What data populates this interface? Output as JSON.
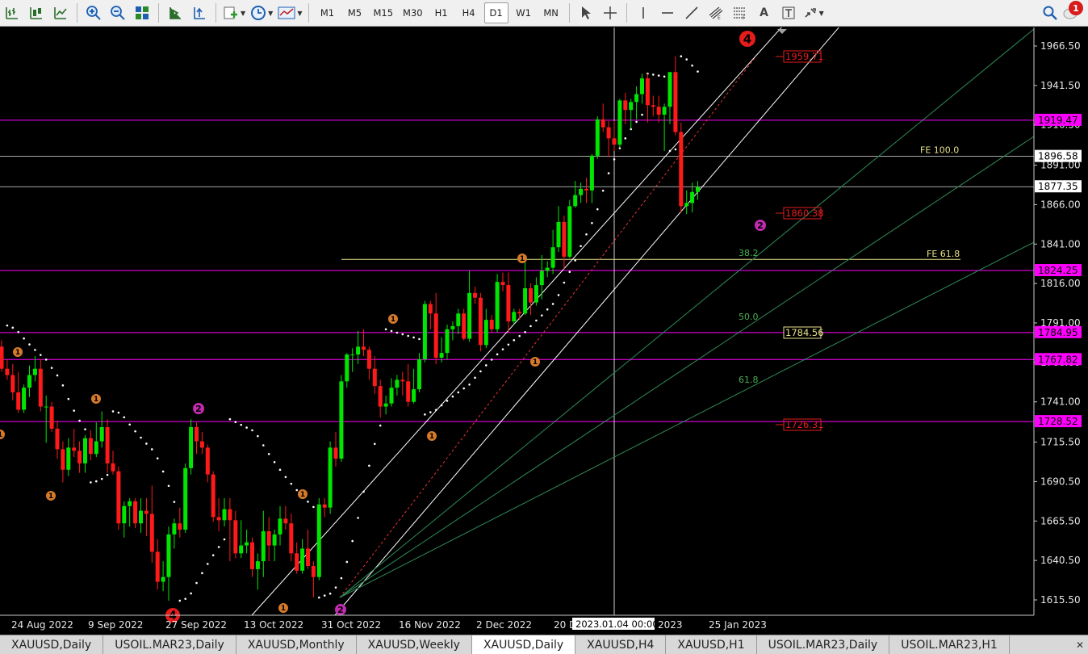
{
  "toolbar": {
    "timeframes": [
      "M1",
      "M5",
      "M15",
      "M30",
      "H1",
      "H4",
      "D1",
      "W1",
      "MN"
    ],
    "active_timeframe": "D1",
    "draw_tool_letter_a": "A",
    "notification_count": "1"
  },
  "chart_data": {
    "type": "candlestick",
    "symbol": "XAUUSD",
    "timeframe": "Daily",
    "y_axis": {
      "ticks": [
        "1966.50",
        "1941.50",
        "1916.50",
        "1891.00",
        "1866.00",
        "1841.00",
        "1816.00",
        "1791.00",
        "1766.00",
        "1741.00",
        "1715.50",
        "1690.50",
        "1665.50",
        "1640.50",
        "1615.50"
      ]
    },
    "x_axis": {
      "labels": [
        "24 Aug 2022",
        "9 Sep 2022",
        "27 Sep 2022",
        "13 Oct 2022",
        "31 Oct 2022",
        "16 Nov 2022",
        "2 Dec 2022",
        "20 D",
        "2023",
        "25 Jan 2023"
      ],
      "crosshair_label": "2023.01.04 00:00"
    },
    "price_labels": {
      "magenta": [
        "1919.47",
        "1824.25",
        "1784.95",
        "1767.82",
        "1728.52"
      ],
      "white": [
        "1896.58",
        "1877.35"
      ],
      "red_boxes": [
        "1959.71",
        "1860.38",
        "1726.31"
      ],
      "yellow_box": "1784.56"
    },
    "horizontal_levels": {
      "magenta": [
        1919.47,
        1824.25,
        1784.95,
        1767.82,
        1728.52
      ],
      "white": [
        1896.58,
        1877.35
      ],
      "yellow_fe618": 1831.3
    },
    "fib_labels": [
      "FE 100.0",
      "FE 61.8",
      "38.2",
      "50.0",
      "61.8"
    ],
    "wave_labels": {
      "red_big": [
        "4",
        "4"
      ],
      "magenta": [
        "2",
        "2",
        "2"
      ],
      "orange": [
        "1",
        "1",
        "1",
        "1",
        "1",
        "1",
        "1",
        "1",
        "1"
      ]
    },
    "candles": [
      {
        "d": "2022-08-17",
        "o": 1776,
        "h": 1780,
        "l": 1760,
        "c": 1762
      },
      {
        "d": "2022-08-18",
        "o": 1762,
        "h": 1768,
        "l": 1755,
        "c": 1758
      },
      {
        "d": "2022-08-19",
        "o": 1758,
        "h": 1765,
        "l": 1742,
        "c": 1747
      },
      {
        "d": "2022-08-22",
        "o": 1747,
        "h": 1760,
        "l": 1734,
        "c": 1736
      },
      {
        "d": "2022-08-23",
        "o": 1736,
        "h": 1752,
        "l": 1734,
        "c": 1750
      },
      {
        "d": "2022-08-24",
        "o": 1750,
        "h": 1764,
        "l": 1744,
        "c": 1758
      },
      {
        "d": "2022-08-25",
        "o": 1758,
        "h": 1770,
        "l": 1754,
        "c": 1762
      },
      {
        "d": "2022-08-26",
        "o": 1762,
        "h": 1768,
        "l": 1735,
        "c": 1738
      },
      {
        "d": "2022-08-29",
        "o": 1738,
        "h": 1745,
        "l": 1715,
        "c": 1738
      },
      {
        "d": "2022-08-30",
        "o": 1738,
        "h": 1741,
        "l": 1722,
        "c": 1724
      },
      {
        "d": "2022-08-31",
        "o": 1724,
        "h": 1729,
        "l": 1705,
        "c": 1711
      },
      {
        "d": "2022-09-01",
        "o": 1711,
        "h": 1716,
        "l": 1690,
        "c": 1698
      },
      {
        "d": "2022-09-02",
        "o": 1698,
        "h": 1718,
        "l": 1694,
        "c": 1712
      },
      {
        "d": "2022-09-05",
        "o": 1712,
        "h": 1724,
        "l": 1706,
        "c": 1710
      },
      {
        "d": "2022-09-06",
        "o": 1710,
        "h": 1716,
        "l": 1696,
        "c": 1702
      },
      {
        "d": "2022-09-07",
        "o": 1702,
        "h": 1720,
        "l": 1696,
        "c": 1718
      },
      {
        "d": "2022-09-08",
        "o": 1718,
        "h": 1723,
        "l": 1704,
        "c": 1708
      },
      {
        "d": "2022-09-09",
        "o": 1708,
        "h": 1728,
        "l": 1706,
        "c": 1716
      },
      {
        "d": "2022-09-12",
        "o": 1716,
        "h": 1735,
        "l": 1712,
        "c": 1725
      },
      {
        "d": "2022-09-13",
        "o": 1725,
        "h": 1730,
        "l": 1696,
        "c": 1702
      },
      {
        "d": "2022-09-14",
        "o": 1702,
        "h": 1710,
        "l": 1695,
        "c": 1697
      },
      {
        "d": "2022-09-15",
        "o": 1697,
        "h": 1700,
        "l": 1660,
        "c": 1664
      },
      {
        "d": "2022-09-16",
        "o": 1664,
        "h": 1678,
        "l": 1655,
        "c": 1675
      },
      {
        "d": "2022-09-19",
        "o": 1675,
        "h": 1680,
        "l": 1662,
        "c": 1678
      },
      {
        "d": "2022-09-20",
        "o": 1678,
        "h": 1680,
        "l": 1661,
        "c": 1664
      },
      {
        "d": "2022-09-21",
        "o": 1664,
        "h": 1680,
        "l": 1658,
        "c": 1672
      },
      {
        "d": "2022-09-22",
        "o": 1672,
        "h": 1680,
        "l": 1656,
        "c": 1670
      },
      {
        "d": "2022-09-23",
        "o": 1670,
        "h": 1688,
        "l": 1639,
        "c": 1646
      },
      {
        "d": "2022-09-26",
        "o": 1646,
        "h": 1654,
        "l": 1622,
        "c": 1627
      },
      {
        "d": "2022-09-27",
        "o": 1627,
        "h": 1640,
        "l": 1621,
        "c": 1630
      },
      {
        "d": "2022-09-28",
        "o": 1630,
        "h": 1662,
        "l": 1615,
        "c": 1657
      },
      {
        "d": "2022-09-29",
        "o": 1657,
        "h": 1667,
        "l": 1648,
        "c": 1664
      },
      {
        "d": "2022-09-30",
        "o": 1664,
        "h": 1674,
        "l": 1655,
        "c": 1660
      },
      {
        "d": "2022-10-03",
        "o": 1660,
        "h": 1702,
        "l": 1658,
        "c": 1699
      },
      {
        "d": "2022-10-04",
        "o": 1699,
        "h": 1730,
        "l": 1695,
        "c": 1725
      },
      {
        "d": "2022-10-05",
        "o": 1725,
        "h": 1728,
        "l": 1708,
        "c": 1716
      },
      {
        "d": "2022-10-06",
        "o": 1716,
        "h": 1722,
        "l": 1708,
        "c": 1712
      },
      {
        "d": "2022-10-07",
        "o": 1712,
        "h": 1714,
        "l": 1690,
        "c": 1695
      },
      {
        "d": "2022-10-10",
        "o": 1695,
        "h": 1697,
        "l": 1665,
        "c": 1668
      },
      {
        "d": "2022-10-11",
        "o": 1668,
        "h": 1680,
        "l": 1659,
        "c": 1666
      },
      {
        "d": "2022-10-12",
        "o": 1666,
        "h": 1680,
        "l": 1662,
        "c": 1673
      },
      {
        "d": "2022-10-13",
        "o": 1673,
        "h": 1680,
        "l": 1640,
        "c": 1666
      },
      {
        "d": "2022-10-14",
        "o": 1666,
        "h": 1672,
        "l": 1642,
        "c": 1645
      },
      {
        "d": "2022-10-17",
        "o": 1645,
        "h": 1666,
        "l": 1642,
        "c": 1650
      },
      {
        "d": "2022-10-18",
        "o": 1650,
        "h": 1660,
        "l": 1645,
        "c": 1652
      },
      {
        "d": "2022-10-19",
        "o": 1652,
        "h": 1655,
        "l": 1630,
        "c": 1635
      },
      {
        "d": "2022-10-20",
        "o": 1635,
        "h": 1645,
        "l": 1622,
        "c": 1640
      },
      {
        "d": "2022-10-21",
        "o": 1640,
        "h": 1672,
        "l": 1630,
        "c": 1659
      },
      {
        "d": "2022-10-24",
        "o": 1659,
        "h": 1668,
        "l": 1640,
        "c": 1650
      },
      {
        "d": "2022-10-25",
        "o": 1650,
        "h": 1660,
        "l": 1640,
        "c": 1657
      },
      {
        "d": "2022-10-26",
        "o": 1657,
        "h": 1675,
        "l": 1650,
        "c": 1667
      },
      {
        "d": "2022-10-27",
        "o": 1667,
        "h": 1675,
        "l": 1660,
        "c": 1664
      },
      {
        "d": "2022-10-28",
        "o": 1664,
        "h": 1670,
        "l": 1640,
        "c": 1645
      },
      {
        "d": "2022-10-31",
        "o": 1645,
        "h": 1652,
        "l": 1632,
        "c": 1634
      },
      {
        "d": "2022-11-01",
        "o": 1634,
        "h": 1654,
        "l": 1632,
        "c": 1648
      },
      {
        "d": "2022-11-02",
        "o": 1648,
        "h": 1660,
        "l": 1635,
        "c": 1637
      },
      {
        "d": "2022-11-03",
        "o": 1637,
        "h": 1640,
        "l": 1617,
        "c": 1630
      },
      {
        "d": "2022-11-04",
        "o": 1630,
        "h": 1680,
        "l": 1628,
        "c": 1676
      },
      {
        "d": "2022-11-07",
        "o": 1676,
        "h": 1680,
        "l": 1668,
        "c": 1674
      },
      {
        "d": "2022-11-08",
        "o": 1674,
        "h": 1716,
        "l": 1670,
        "c": 1712
      },
      {
        "d": "2022-11-09",
        "o": 1712,
        "h": 1722,
        "l": 1700,
        "c": 1705
      },
      {
        "d": "2022-11-10",
        "o": 1705,
        "h": 1758,
        "l": 1703,
        "c": 1754
      },
      {
        "d": "2022-11-11",
        "o": 1754,
        "h": 1772,
        "l": 1750,
        "c": 1771
      },
      {
        "d": "2022-11-14",
        "o": 1771,
        "h": 1775,
        "l": 1760,
        "c": 1771
      },
      {
        "d": "2022-11-15",
        "o": 1771,
        "h": 1786,
        "l": 1765,
        "c": 1776
      },
      {
        "d": "2022-11-16",
        "o": 1776,
        "h": 1787,
        "l": 1770,
        "c": 1774
      },
      {
        "d": "2022-11-17",
        "o": 1774,
        "h": 1776,
        "l": 1755,
        "c": 1762
      },
      {
        "d": "2022-11-18",
        "o": 1762,
        "h": 1770,
        "l": 1746,
        "c": 1751
      },
      {
        "d": "2022-11-21",
        "o": 1751,
        "h": 1755,
        "l": 1731,
        "c": 1738
      },
      {
        "d": "2022-11-22",
        "o": 1738,
        "h": 1745,
        "l": 1733,
        "c": 1740
      },
      {
        "d": "2022-11-23",
        "o": 1740,
        "h": 1756,
        "l": 1738,
        "c": 1750
      },
      {
        "d": "2022-11-24",
        "o": 1750,
        "h": 1758,
        "l": 1745,
        "c": 1755
      },
      {
        "d": "2022-11-25",
        "o": 1755,
        "h": 1760,
        "l": 1745,
        "c": 1754
      },
      {
        "d": "2022-11-28",
        "o": 1754,
        "h": 1765,
        "l": 1738,
        "c": 1741
      },
      {
        "d": "2022-11-29",
        "o": 1741,
        "h": 1762,
        "l": 1740,
        "c": 1749
      },
      {
        "d": "2022-11-30",
        "o": 1749,
        "h": 1772,
        "l": 1747,
        "c": 1768
      },
      {
        "d": "2022-12-01",
        "o": 1768,
        "h": 1805,
        "l": 1766,
        "c": 1803
      },
      {
        "d": "2022-12-02",
        "o": 1803,
        "h": 1805,
        "l": 1787,
        "c": 1797
      },
      {
        "d": "2022-12-05",
        "o": 1797,
        "h": 1810,
        "l": 1765,
        "c": 1769
      },
      {
        "d": "2022-12-06",
        "o": 1769,
        "h": 1782,
        "l": 1766,
        "c": 1772
      },
      {
        "d": "2022-12-07",
        "o": 1772,
        "h": 1790,
        "l": 1768,
        "c": 1787
      },
      {
        "d": "2022-12-08",
        "o": 1787,
        "h": 1792,
        "l": 1780,
        "c": 1789
      },
      {
        "d": "2022-12-09",
        "o": 1789,
        "h": 1800,
        "l": 1784,
        "c": 1797
      },
      {
        "d": "2022-12-12",
        "o": 1797,
        "h": 1800,
        "l": 1780,
        "c": 1781
      },
      {
        "d": "2022-12-13",
        "o": 1781,
        "h": 1824,
        "l": 1779,
        "c": 1810
      },
      {
        "d": "2022-12-14",
        "o": 1810,
        "h": 1814,
        "l": 1803,
        "c": 1807
      },
      {
        "d": "2022-12-15",
        "o": 1807,
        "h": 1810,
        "l": 1773,
        "c": 1777
      },
      {
        "d": "2022-12-16",
        "o": 1777,
        "h": 1800,
        "l": 1775,
        "c": 1793
      },
      {
        "d": "2022-12-19",
        "o": 1793,
        "h": 1796,
        "l": 1785,
        "c": 1787
      },
      {
        "d": "2022-12-20",
        "o": 1787,
        "h": 1822,
        "l": 1785,
        "c": 1817
      },
      {
        "d": "2022-12-21",
        "o": 1817,
        "h": 1823,
        "l": 1811,
        "c": 1815
      },
      {
        "d": "2022-12-22",
        "o": 1815,
        "h": 1823,
        "l": 1785,
        "c": 1792
      },
      {
        "d": "2022-12-23",
        "o": 1792,
        "h": 1800,
        "l": 1790,
        "c": 1798
      },
      {
        "d": "2022-12-26",
        "o": 1798,
        "h": 1800,
        "l": 1793,
        "c": 1797
      },
      {
        "d": "2022-12-27",
        "o": 1797,
        "h": 1833,
        "l": 1796,
        "c": 1813
      },
      {
        "d": "2022-12-28",
        "o": 1813,
        "h": 1816,
        "l": 1796,
        "c": 1804
      },
      {
        "d": "2022-12-29",
        "o": 1804,
        "h": 1820,
        "l": 1802,
        "c": 1815
      },
      {
        "d": "2022-12-30",
        "o": 1815,
        "h": 1834,
        "l": 1806,
        "c": 1824
      },
      {
        "d": "2023-01-02",
        "o": 1824,
        "h": 1830,
        "l": 1820,
        "c": 1826
      },
      {
        "d": "2023-01-03",
        "o": 1826,
        "h": 1850,
        "l": 1822,
        "c": 1839
      },
      {
        "d": "2023-01-04",
        "o": 1839,
        "h": 1865,
        "l": 1836,
        "c": 1855
      },
      {
        "d": "2023-01-05",
        "o": 1855,
        "h": 1859,
        "l": 1825,
        "c": 1833
      },
      {
        "d": "2023-01-06",
        "o": 1833,
        "h": 1869,
        "l": 1832,
        "c": 1865
      },
      {
        "d": "2023-01-09",
        "o": 1865,
        "h": 1881,
        "l": 1864,
        "c": 1872
      },
      {
        "d": "2023-01-10",
        "o": 1872,
        "h": 1880,
        "l": 1867,
        "c": 1876
      },
      {
        "d": "2023-01-11",
        "o": 1876,
        "h": 1883,
        "l": 1867,
        "c": 1875
      },
      {
        "d": "2023-01-12",
        "o": 1875,
        "h": 1898,
        "l": 1867,
        "c": 1897
      },
      {
        "d": "2023-01-13",
        "o": 1897,
        "h": 1922,
        "l": 1895,
        "c": 1920
      },
      {
        "d": "2023-01-16",
        "o": 1920,
        "h": 1930,
        "l": 1912,
        "c": 1915
      },
      {
        "d": "2023-01-17",
        "o": 1915,
        "h": 1919,
        "l": 1896,
        "c": 1908
      },
      {
        "d": "2023-01-18",
        "o": 1908,
        "h": 1919,
        "l": 1900,
        "c": 1904
      },
      {
        "d": "2023-01-19",
        "o": 1904,
        "h": 1933,
        "l": 1902,
        "c": 1932
      },
      {
        "d": "2023-01-20",
        "o": 1932,
        "h": 1937,
        "l": 1917,
        "c": 1926
      },
      {
        "d": "2023-01-23",
        "o": 1926,
        "h": 1933,
        "l": 1914,
        "c": 1931
      },
      {
        "d": "2023-01-24",
        "o": 1931,
        "h": 1941,
        "l": 1920,
        "c": 1936
      },
      {
        "d": "2023-01-25",
        "o": 1936,
        "h": 1949,
        "l": 1930,
        "c": 1946
      },
      {
        "d": "2023-01-26",
        "o": 1946,
        "h": 1949,
        "l": 1918,
        "c": 1929
      },
      {
        "d": "2023-01-27",
        "o": 1929,
        "h": 1935,
        "l": 1922,
        "c": 1928
      },
      {
        "d": "2023-01-30",
        "o": 1928,
        "h": 1935,
        "l": 1918,
        "c": 1923
      },
      {
        "d": "2023-01-31",
        "o": 1923,
        "h": 1930,
        "l": 1900,
        "c": 1928
      },
      {
        "d": "2023-02-01",
        "o": 1928,
        "h": 1950,
        "l": 1917,
        "c": 1950
      },
      {
        "d": "2023-02-02",
        "o": 1950,
        "h": 1960,
        "l": 1910,
        "c": 1912
      },
      {
        "d": "2023-02-03",
        "o": 1912,
        "h": 1918,
        "l": 1861,
        "c": 1865
      },
      {
        "d": "2023-02-06",
        "o": 1865,
        "h": 1875,
        "l": 1860,
        "c": 1867
      },
      {
        "d": "2023-02-07",
        "o": 1867,
        "h": 1880,
        "l": 1861,
        "c": 1874
      },
      {
        "d": "2023-02-08",
        "o": 1874,
        "h": 1881,
        "l": 1869,
        "c": 1877
      }
    ]
  },
  "tabs": [
    {
      "label": "XAUUSD,Daily"
    },
    {
      "label": "USOIL.MAR23,Daily"
    },
    {
      "label": "XAUUSD,Monthly"
    },
    {
      "label": "XAUUSD,Weekly"
    },
    {
      "label": "XAUUSD,Daily"
    },
    {
      "label": "XAUUSD,H4"
    },
    {
      "label": "XAUUSD,H1"
    },
    {
      "label": "USOIL.MAR23,Daily"
    },
    {
      "label": "USOIL.MAR23,H1"
    }
  ],
  "active_tab_index": 4,
  "colors": {
    "bull": "#00e600",
    "bear": "#ff1a1a",
    "magenta": "#ff00ff",
    "fib_green": "#2e8b57",
    "fe_yellow": "#e8e08a",
    "psar_dots": "#ffffff"
  }
}
